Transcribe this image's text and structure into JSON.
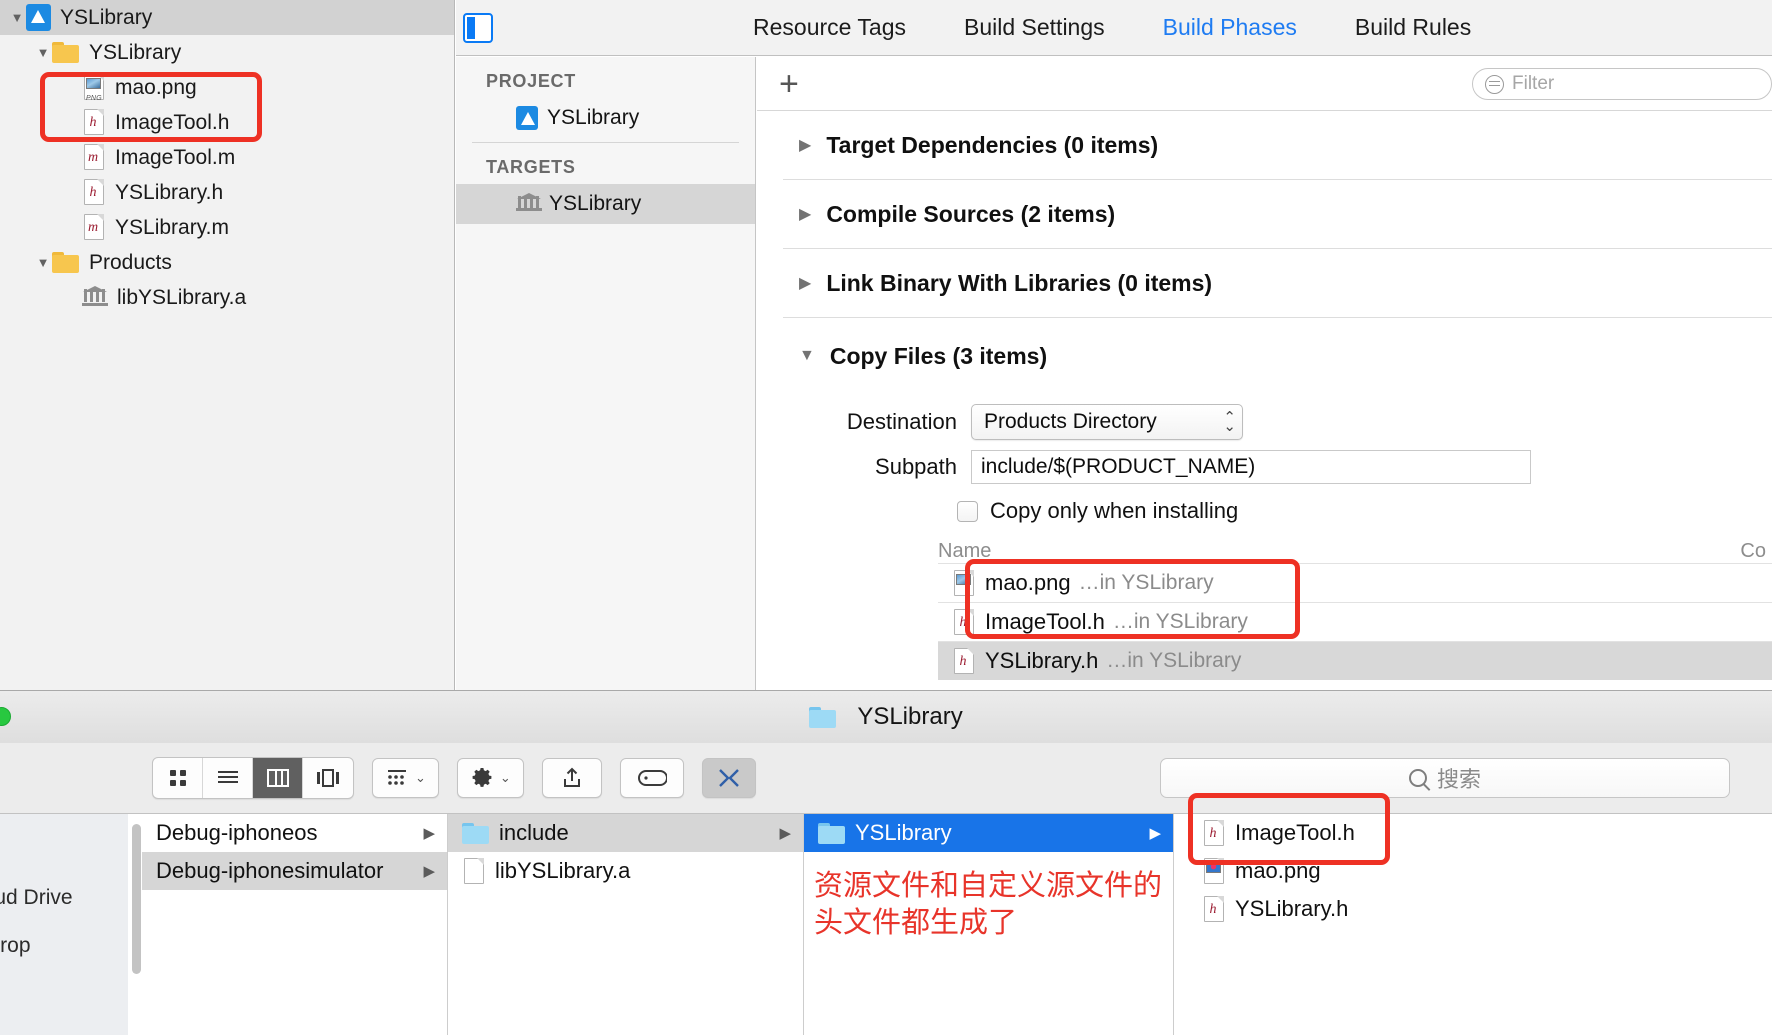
{
  "xcode": {
    "navigator": {
      "items": [
        {
          "label": "YSLibrary",
          "icon": "xcode-project-icon",
          "indent": 0,
          "disclosure": "open",
          "selected": true
        },
        {
          "label": "YSLibrary",
          "icon": "folder-icon",
          "indent": 1,
          "disclosure": "open",
          "selected": false
        },
        {
          "label": "mao.png",
          "icon": "png-file-icon",
          "indent": 2,
          "disclosure": "none",
          "selected": false
        },
        {
          "label": "ImageTool.h",
          "icon": "header-file-icon",
          "indent": 2,
          "disclosure": "none",
          "selected": false
        },
        {
          "label": "ImageTool.m",
          "icon": "objc-file-icon",
          "indent": 2,
          "disclosure": "none",
          "selected": false
        },
        {
          "label": "YSLibrary.h",
          "icon": "header-file-icon",
          "indent": 2,
          "disclosure": "none",
          "selected": false
        },
        {
          "label": "YSLibrary.m",
          "icon": "objc-file-icon",
          "indent": 2,
          "disclosure": "none",
          "selected": false
        },
        {
          "label": "Products",
          "icon": "folder-icon",
          "indent": 1,
          "disclosure": "open",
          "selected": false
        },
        {
          "label": "libYSLibrary.a",
          "icon": "static-library-icon",
          "indent": 2,
          "disclosure": "none",
          "selected": false
        }
      ]
    },
    "tabs": [
      {
        "label": "Resource Tags",
        "active": false
      },
      {
        "label": "Build Settings",
        "active": false
      },
      {
        "label": "Build Phases",
        "active": true
      },
      {
        "label": "Build Rules",
        "active": false
      }
    ],
    "targets_sidebar": {
      "project_header": "PROJECT",
      "project_items": [
        {
          "label": "YSLibrary"
        }
      ],
      "targets_header": "TARGETS",
      "target_items": [
        {
          "label": "YSLibrary",
          "selected": true
        }
      ]
    },
    "phases_toolbar": {
      "add_label": "+",
      "filter_placeholder": "Filter"
    },
    "phases": [
      {
        "title": "Target Dependencies (0 items)",
        "expanded": false
      },
      {
        "title": "Compile Sources (2 items)",
        "expanded": false
      },
      {
        "title": "Link Binary With Libraries (0 items)",
        "expanded": false
      },
      {
        "title": "Copy Files (3 items)",
        "expanded": true
      }
    ],
    "copy_files": {
      "destination_label": "Destination",
      "destination_value": "Products Directory",
      "subpath_label": "Subpath",
      "subpath_value": "include/$(PRODUCT_NAME)",
      "copy_only_label": "Copy only when installing",
      "copy_only_checked": false,
      "column_name": "Name",
      "column_code_sign": "Co",
      "rows": [
        {
          "name": "mao.png",
          "location": "…in YSLibrary",
          "icon": "png-file-icon",
          "selected": false
        },
        {
          "name": "ImageTool.h",
          "location": "…in YSLibrary",
          "icon": "header-file-icon",
          "selected": false
        },
        {
          "name": "YSLibrary.h",
          "location": "…in YSLibrary",
          "icon": "header-file-icon",
          "selected": true
        }
      ]
    }
  },
  "finder": {
    "title": "YSLibrary",
    "toolbar": {
      "view_buttons": [
        {
          "icon": "icon-view-icon",
          "active": false
        },
        {
          "icon": "list-view-icon",
          "active": false
        },
        {
          "icon": "column-view-icon",
          "active": true
        },
        {
          "icon": "gallery-view-icon",
          "active": false
        }
      ],
      "group_button": "group-by-icon",
      "action_button": "gear-icon",
      "share_button": "share-icon",
      "tags_button": "tag-icon",
      "terminal_button": "terminal-icon"
    },
    "search_placeholder": "搜索",
    "sidebar": [
      {
        "label": "loud Drive"
      },
      {
        "label": "rDrop"
      }
    ],
    "columns": [
      {
        "rows": [
          {
            "label": "Debug-iphoneos",
            "icon": "none",
            "hasArrow": true,
            "state": "normal"
          },
          {
            "label": "Debug-iphonesimulator",
            "icon": "none",
            "hasArrow": true,
            "state": "selected-gray"
          }
        ]
      },
      {
        "rows": [
          {
            "label": "include",
            "icon": "blue-folder-icon",
            "hasArrow": true,
            "state": "selected-gray"
          },
          {
            "label": "libYSLibrary.a",
            "icon": "generic-file-icon",
            "hasArrow": false,
            "state": "normal"
          }
        ]
      },
      {
        "rows": [
          {
            "label": "YSLibrary",
            "icon": "blue-folder-icon",
            "hasArrow": true,
            "state": "selected-blue"
          }
        ]
      },
      {
        "rows": [
          {
            "label": "ImageTool.h",
            "icon": "header-file-icon",
            "hasArrow": false,
            "state": "normal"
          },
          {
            "label": "mao.png",
            "icon": "png-file-icon",
            "hasArrow": false,
            "state": "normal"
          },
          {
            "label": "YSLibrary.h",
            "icon": "header-file-icon",
            "hasArrow": false,
            "state": "normal"
          }
        ]
      }
    ],
    "annotation": {
      "line1": "资源文件和自定义源文件的",
      "line2": "头文件都生成了"
    }
  },
  "colors": {
    "annotation_red": "#ee3124",
    "accent_blue": "#1f7cf2",
    "selection_blue": "#1874e8"
  }
}
